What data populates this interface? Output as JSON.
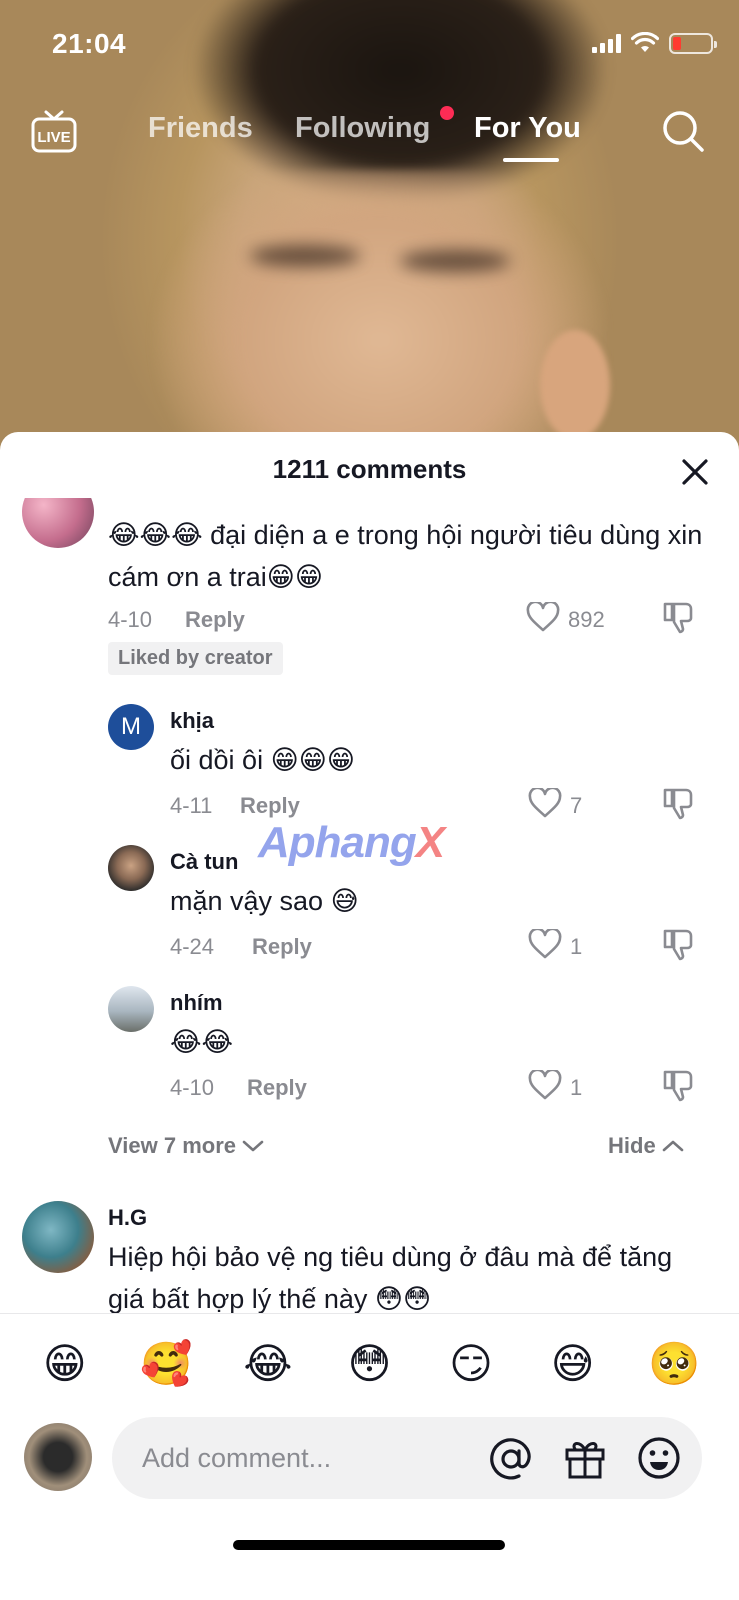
{
  "status_bar": {
    "time": "21:04"
  },
  "top_nav": {
    "live_label": "LIVE",
    "tabs": [
      {
        "label": "Friends"
      },
      {
        "label": "Following"
      },
      {
        "label": "For You"
      }
    ],
    "active_tab": "For You"
  },
  "comments_panel": {
    "title": "1211 comments",
    "comments": [
      {
        "author": "",
        "text": "😂😂😂 đại diện a e trong hội người tiêu dùng xin cám ơn a trai😁😁",
        "date": "4-10",
        "reply_label": "Reply",
        "likes": "892",
        "badge": "Liked by creator"
      }
    ],
    "replies": [
      {
        "avatar_letter": "M",
        "author": "khịa",
        "text": "ối dồi ôi 😁😁😁",
        "date": "4-11",
        "reply_label": "Reply",
        "likes": "7"
      },
      {
        "author": "Cà tun",
        "text": "mặn vậy sao 😅",
        "date": "4-24",
        "reply_label": "Reply",
        "likes": "1"
      },
      {
        "author": "nhím",
        "text": "😂😂",
        "date": "4-10",
        "reply_label": "Reply",
        "likes": "1"
      }
    ],
    "view_more_label": "View 7 more",
    "hide_label": "Hide",
    "next_comment": {
      "author": "H.G",
      "text": "Hiệp hội bảo vệ ng tiêu dùng ở đâu mà để tăng giá bất hợp lý thế này 😳😳"
    },
    "watermark": {
      "main": "Aphang",
      "x": "X"
    }
  },
  "emoji_bar": [
    "😁",
    "🥰",
    "😂",
    "😳",
    "😏",
    "😅",
    "🥺"
  ],
  "input": {
    "placeholder": "Add comment..."
  },
  "colors": {
    "accent_dot": "#fe2c55",
    "muted": "#8a8b91",
    "battery_low": "#ff3b30"
  }
}
